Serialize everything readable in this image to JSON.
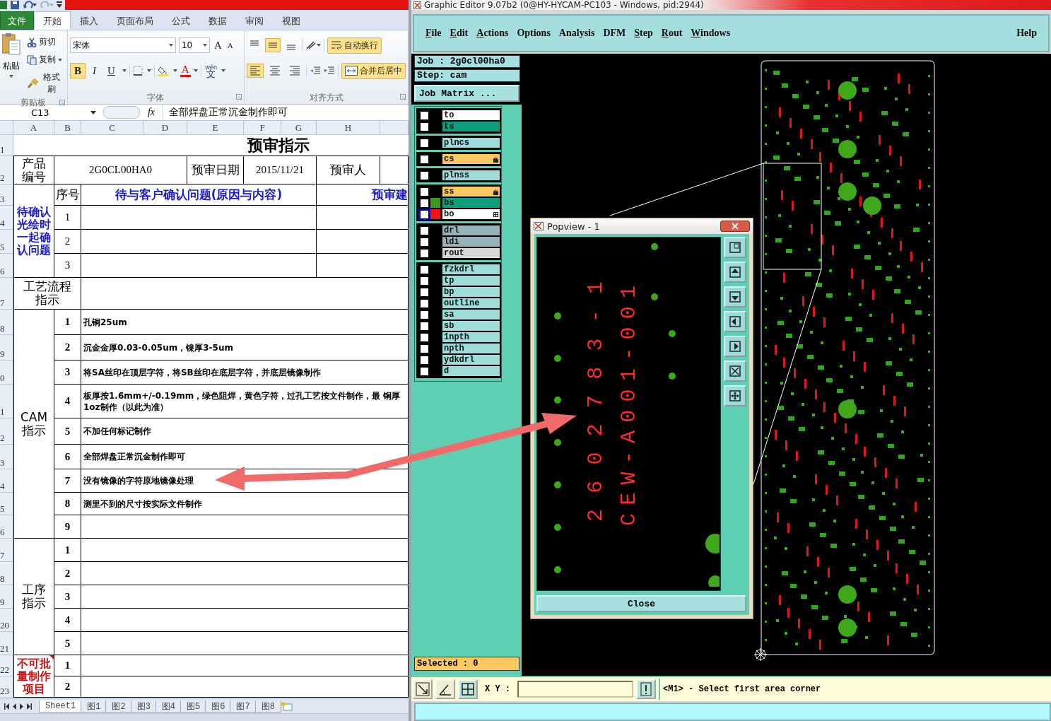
{
  "excel": {
    "tabs": [
      {
        "label": "文件",
        "kind": "file",
        "selected": false
      },
      {
        "label": "开始",
        "kind": "tab",
        "selected": true
      },
      {
        "label": "插入",
        "kind": "tab",
        "selected": false
      },
      {
        "label": "页面布局",
        "kind": "tab",
        "selected": false
      },
      {
        "label": "公式",
        "kind": "tab",
        "selected": false
      },
      {
        "label": "数据",
        "kind": "tab",
        "selected": false
      },
      {
        "label": "审阅",
        "kind": "tab",
        "selected": false
      },
      {
        "label": "视图",
        "kind": "tab",
        "selected": false
      }
    ],
    "clipboard": {
      "paste": "粘贴",
      "cut": "剪切",
      "copy": "复制",
      "format_painter": "格式刷",
      "label": "剪贴板"
    },
    "font": {
      "name": "宋体",
      "size": "10",
      "grow": "A",
      "shrink": "A",
      "font_color": "A",
      "phonetic_top": "wén",
      "phonetic": "文",
      "label": "字体",
      "styles": [
        {
          "label": "B",
          "kind": "bold",
          "selected": true
        },
        {
          "label": "I",
          "kind": "italic",
          "selected": false
        },
        {
          "label": "U",
          "kind": "underline",
          "selected": false
        }
      ]
    },
    "alignment": {
      "vertical": [
        {
          "kind": "top",
          "selected": false
        },
        {
          "kind": "middle",
          "selected": true
        },
        {
          "kind": "bottom",
          "selected": false
        }
      ],
      "horizontal": [
        {
          "kind": "left",
          "selected": true
        },
        {
          "kind": "center",
          "selected": false
        },
        {
          "kind": "right",
          "selected": false
        }
      ],
      "wrap_text": true,
      "merge": true,
      "wrap_label": "自动换行",
      "merge_label": "合并后居中",
      "label": "对齐方式"
    },
    "name_box": "C13",
    "function_label": "fx",
    "formula": "全部焊盘正常沉金制作即可",
    "columns": [
      "A",
      "B",
      "C",
      "D",
      "E",
      "F",
      "G",
      "H"
    ],
    "row_numbers": [
      "1",
      "2",
      "3",
      "4",
      "5",
      "6",
      "7",
      "8",
      "9",
      "0",
      "1",
      "2",
      "3",
      "4",
      "5",
      "6",
      "7",
      "8",
      "9",
      "20",
      "21",
      "22",
      "23"
    ],
    "sheet": {
      "title": "预审指示",
      "product_label": "产品编号",
      "product_value": "2G0CL00HA0",
      "date_label": "预审日期",
      "date_value": "2015/11/21",
      "reviewer_label": "预审人",
      "confirm": {
        "label": "待确认光绘时一起确认问题",
        "seq_header": "序号",
        "question_header": "待与客户确认问题(原因与内容)",
        "suggestion_header": "预审建",
        "items": [
          "1",
          "2",
          "3"
        ]
      },
      "process_label": "工艺流程指示",
      "cam": {
        "label": "CAM指示",
        "items": [
          {
            "no": "1",
            "text": "孔铜25um"
          },
          {
            "no": "2",
            "text": "沉金金厚0.03-0.05um，镍厚3-5um"
          },
          {
            "no": "3",
            "text": "将SA丝印在顶层字符，将SB丝印在底层字符，并底层镜像制作"
          },
          {
            "no": "4",
            "text": "板厚按1.6mm+/-0.19mm，绿色阻焊，黄色字符，过孔工艺按文件制作，最 铜厚1oz制作（以此为准）"
          },
          {
            "no": "5",
            "text": "不加任何标记制作"
          },
          {
            "no": "6",
            "text": "全部焊盘正常沉金制作即可"
          },
          {
            "no": "7",
            "text": "没有镜像的字符原地镜像处理"
          },
          {
            "no": "8",
            "text": "测里不到的尺寸按实际文件制作"
          },
          {
            "no": "9"
          }
        ]
      },
      "procedure": {
        "label": "工序指示",
        "items": [
          "1",
          "2",
          "3",
          "4",
          "5"
        ]
      },
      "no_batch": {
        "label": "不可批量制作项目",
        "items": [
          "1",
          "2"
        ]
      }
    },
    "sheet_tabs": [
      {
        "label": "Sheet1",
        "selected": true
      },
      {
        "label": "图1",
        "selected": false
      },
      {
        "label": "图2",
        "selected": false
      },
      {
        "label": "图3",
        "selected": false
      },
      {
        "label": "图4",
        "selected": false
      },
      {
        "label": "图5",
        "selected": false
      },
      {
        "label": "图6",
        "selected": false
      },
      {
        "label": "图7",
        "selected": false
      },
      {
        "label": "图8",
        "selected": false
      }
    ]
  },
  "editor": {
    "title": "Graphic Editor 9.07b2 (0@HY-HYCAM-PC103 - Windows, pid:2944)",
    "menus": [
      {
        "label": "File",
        "underline_first": true
      },
      {
        "label": "Edit",
        "underline_first": true
      },
      {
        "label": "Actions",
        "underline_first": true
      },
      {
        "label": "Options",
        "underline_first": false
      },
      {
        "label": "Analysis",
        "underline_first": false
      },
      {
        "label": "DFM",
        "underline_first": false
      },
      {
        "label": "Step",
        "underline_first": true
      },
      {
        "label": "Rout",
        "underline_first": true
      },
      {
        "label": "Windows",
        "underline_first": true
      }
    ],
    "help_menu": "Help",
    "job": "Job : 2g0cl00ha0",
    "step": "Step: cam",
    "job_matrix": "Job Matrix ...",
    "layer_groups": [
      {
        "layers": [
          {
            "name": "to",
            "kind": "silk",
            "checked": false,
            "affected": false,
            "work": false
          },
          {
            "name": "ts",
            "kind": "mask",
            "checked": false,
            "affected": false,
            "work": false
          }
        ]
      },
      {
        "layers": [
          {
            "name": "plncs",
            "kind": "misc",
            "checked": false,
            "affected": false,
            "work": false
          }
        ]
      },
      {
        "layers": [
          {
            "name": "cs",
            "kind": "signal",
            "checked": false,
            "affected": true,
            "work": false
          }
        ]
      },
      {
        "layers": [
          {
            "name": "plnss",
            "kind": "misc",
            "checked": false,
            "affected": false,
            "work": false
          }
        ]
      },
      {
        "layers": [
          {
            "name": "ss",
            "kind": "signal",
            "checked": false,
            "affected": true,
            "work": false
          },
          {
            "name": "bs",
            "kind": "mask",
            "checked": false,
            "affected": false,
            "work": false,
            "color": "#3c9a1c"
          },
          {
            "name": "bo",
            "kind": "silk",
            "checked": false,
            "affected": false,
            "work": true,
            "color": "#ff1010"
          }
        ]
      },
      {
        "layers": [
          {
            "name": "drl",
            "kind": "drill",
            "checked": false,
            "affected": false,
            "work": false
          },
          {
            "name": "ldi",
            "kind": "drill",
            "checked": false,
            "affected": false,
            "work": false
          },
          {
            "name": "rout",
            "kind": "rout",
            "checked": false,
            "affected": false,
            "work": false
          }
        ]
      },
      {
        "layers": [
          {
            "name": "fzkdrl",
            "kind": "misc",
            "checked": false,
            "affected": false,
            "work": false
          },
          {
            "name": "tp",
            "kind": "misc",
            "checked": false,
            "affected": false,
            "work": false
          },
          {
            "name": "bp",
            "kind": "misc",
            "checked": false,
            "affected": false,
            "work": false
          },
          {
            "name": "outline",
            "kind": "misc",
            "checked": false,
            "affected": false,
            "work": false
          },
          {
            "name": "sa",
            "kind": "misc",
            "checked": false,
            "affected": false,
            "work": false
          },
          {
            "name": "sb",
            "kind": "misc",
            "checked": false,
            "affected": false,
            "work": false
          },
          {
            "name": "1npth",
            "kind": "misc",
            "checked": false,
            "affected": false,
            "work": false
          },
          {
            "name": "npth",
            "kind": "misc",
            "checked": false,
            "affected": false,
            "work": false
          },
          {
            "name": "ydkdrl",
            "kind": "misc",
            "checked": false,
            "affected": false,
            "work": false
          },
          {
            "name": "d",
            "kind": "misc",
            "checked": false,
            "affected": false,
            "work": false
          }
        ]
      }
    ],
    "selected": "Selected : 0",
    "popview": {
      "title": "Popview - 1",
      "texts": [
        "2602783-1",
        "CEW-A001-001"
      ],
      "close": "Close"
    },
    "xy_label": "X Y :",
    "message": "<M1> - Select first area corner"
  }
}
